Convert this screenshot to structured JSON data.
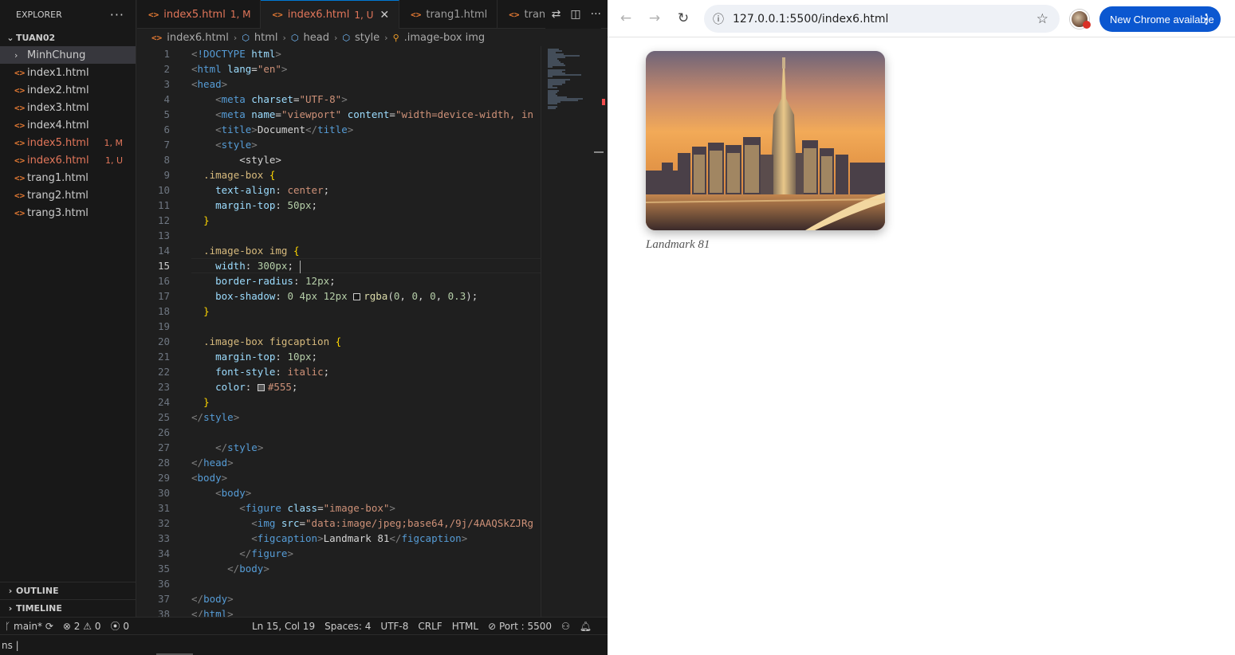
{
  "explorer": {
    "header": "EXPLORER",
    "more": "···",
    "folder": "TUAN02",
    "items": [
      {
        "name": "MinhChung",
        "type": "folder",
        "badge": ""
      },
      {
        "name": "index1.html",
        "type": "file",
        "badge": ""
      },
      {
        "name": "index2.html",
        "type": "file",
        "badge": ""
      },
      {
        "name": "index3.html",
        "type": "file",
        "badge": ""
      },
      {
        "name": "index4.html",
        "type": "file",
        "badge": ""
      },
      {
        "name": "index5.html",
        "type": "file",
        "badge": "1, M"
      },
      {
        "name": "index6.html",
        "type": "file",
        "badge": "1, U"
      },
      {
        "name": "trang1.html",
        "type": "file",
        "badge": ""
      },
      {
        "name": "trang2.html",
        "type": "file",
        "badge": ""
      },
      {
        "name": "trang3.html",
        "type": "file",
        "badge": ""
      }
    ],
    "outline": "OUTLINE",
    "timeline": "TIMELINE"
  },
  "tabs": [
    {
      "name": "index5.html",
      "badge": "1, M"
    },
    {
      "name": "index6.html",
      "badge": "1, U"
    },
    {
      "name": "trang1.html",
      "badge": ""
    },
    {
      "name": "trang",
      "badge": ""
    }
  ],
  "breadcrumb": [
    "index6.html",
    "html",
    "head",
    "style",
    ".image-box img"
  ],
  "status": {
    "branch": "main*",
    "errors": "2",
    "warnings": "0",
    "ports": "0",
    "position": "Ln 15, Col 19",
    "spaces": "Spaces: 4",
    "encoding": "UTF-8",
    "eol": "CRLF",
    "language": "HTML",
    "port": "Port : 5500"
  },
  "terminal": {
    "text": "ns |"
  },
  "browser": {
    "url": "127.0.0.1:5500/index6.html",
    "update_label": "New Chrome available",
    "caption": "Landmark 81"
  },
  "colors": {
    "accent": "#0078d4",
    "modified": "#e2765a",
    "chrome_blue": "#0b57d0",
    "caption": "#555555"
  }
}
